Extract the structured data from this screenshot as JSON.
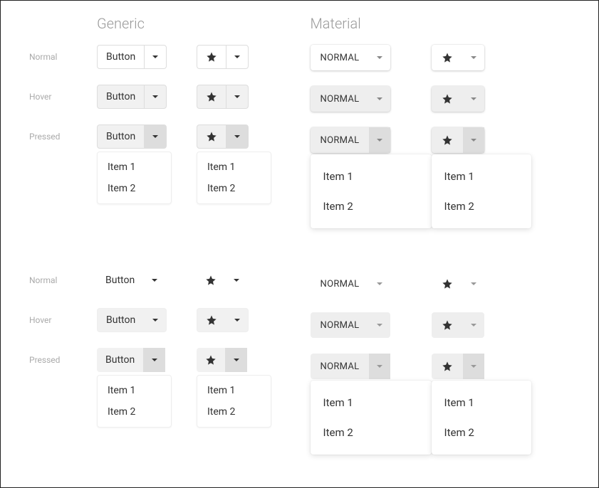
{
  "columns": {
    "generic": {
      "title": "Generic",
      "button_label": "Button"
    },
    "material": {
      "title": "Material",
      "button_label": "NORMAL"
    }
  },
  "states": {
    "normal": "Normal",
    "hover": "Hover",
    "pressed": "Pressed"
  },
  "menu": {
    "item1": "Item 1",
    "item2": "Item 2"
  }
}
